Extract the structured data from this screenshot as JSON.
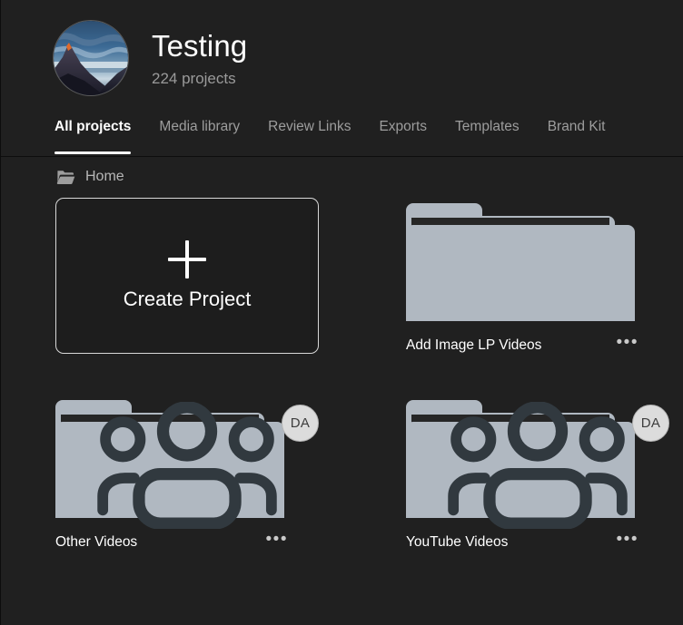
{
  "workspace": {
    "name": "Testing",
    "project_count_label": "224 projects",
    "avatar_name": "workspace-avatar-mountain-photo"
  },
  "tabs": [
    {
      "label": "All projects",
      "active": true
    },
    {
      "label": "Media library",
      "active": false
    },
    {
      "label": "Review Links",
      "active": false
    },
    {
      "label": "Exports",
      "active": false
    },
    {
      "label": "Templates",
      "active": false
    },
    {
      "label": "Brand Kit",
      "active": false
    }
  ],
  "breadcrumb": {
    "icon": "folder-open-icon",
    "label": "Home"
  },
  "create_project": {
    "icon": "plus-icon",
    "label": "Create Project"
  },
  "folders": [
    {
      "name": "Add Image LP Videos",
      "shared": false,
      "avatar_initials": "",
      "menu_label": "•••"
    },
    {
      "name": "Other Videos",
      "shared": true,
      "avatar_initials": "DA",
      "menu_label": "•••"
    },
    {
      "name": "YouTube Videos",
      "shared": true,
      "avatar_initials": "DA",
      "menu_label": "•••"
    }
  ],
  "colors": {
    "background": "#202020",
    "divider": "#0d0d0d",
    "active_tab": "#ffffff",
    "inactive_tab": "#9d9d9d",
    "folder_fill": "#b0b8c1",
    "folder_gap": "#262626",
    "avatar_badge": "#dcdcdc"
  }
}
